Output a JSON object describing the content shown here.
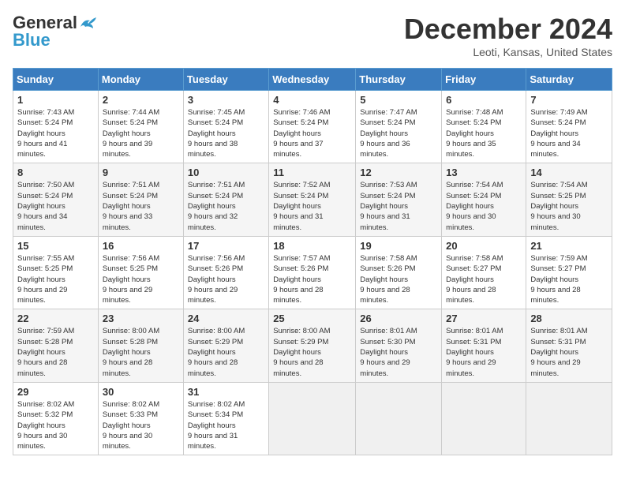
{
  "header": {
    "logo_general": "General",
    "logo_blue": "Blue",
    "title": "December 2024",
    "location": "Leoti, Kansas, United States"
  },
  "weekdays": [
    "Sunday",
    "Monday",
    "Tuesday",
    "Wednesday",
    "Thursday",
    "Friday",
    "Saturday"
  ],
  "weeks": [
    [
      {
        "day": "1",
        "sunrise": "7:43 AM",
        "sunset": "5:24 PM",
        "daylight": "9 hours and 41 minutes."
      },
      {
        "day": "2",
        "sunrise": "7:44 AM",
        "sunset": "5:24 PM",
        "daylight": "9 hours and 39 minutes."
      },
      {
        "day": "3",
        "sunrise": "7:45 AM",
        "sunset": "5:24 PM",
        "daylight": "9 hours and 38 minutes."
      },
      {
        "day": "4",
        "sunrise": "7:46 AM",
        "sunset": "5:24 PM",
        "daylight": "9 hours and 37 minutes."
      },
      {
        "day": "5",
        "sunrise": "7:47 AM",
        "sunset": "5:24 PM",
        "daylight": "9 hours and 36 minutes."
      },
      {
        "day": "6",
        "sunrise": "7:48 AM",
        "sunset": "5:24 PM",
        "daylight": "9 hours and 35 minutes."
      },
      {
        "day": "7",
        "sunrise": "7:49 AM",
        "sunset": "5:24 PM",
        "daylight": "9 hours and 34 minutes."
      }
    ],
    [
      {
        "day": "8",
        "sunrise": "7:50 AM",
        "sunset": "5:24 PM",
        "daylight": "9 hours and 34 minutes."
      },
      {
        "day": "9",
        "sunrise": "7:51 AM",
        "sunset": "5:24 PM",
        "daylight": "9 hours and 33 minutes."
      },
      {
        "day": "10",
        "sunrise": "7:51 AM",
        "sunset": "5:24 PM",
        "daylight": "9 hours and 32 minutes."
      },
      {
        "day": "11",
        "sunrise": "7:52 AM",
        "sunset": "5:24 PM",
        "daylight": "9 hours and 31 minutes."
      },
      {
        "day": "12",
        "sunrise": "7:53 AM",
        "sunset": "5:24 PM",
        "daylight": "9 hours and 31 minutes."
      },
      {
        "day": "13",
        "sunrise": "7:54 AM",
        "sunset": "5:24 PM",
        "daylight": "9 hours and 30 minutes."
      },
      {
        "day": "14",
        "sunrise": "7:54 AM",
        "sunset": "5:25 PM",
        "daylight": "9 hours and 30 minutes."
      }
    ],
    [
      {
        "day": "15",
        "sunrise": "7:55 AM",
        "sunset": "5:25 PM",
        "daylight": "9 hours and 29 minutes."
      },
      {
        "day": "16",
        "sunrise": "7:56 AM",
        "sunset": "5:25 PM",
        "daylight": "9 hours and 29 minutes."
      },
      {
        "day": "17",
        "sunrise": "7:56 AM",
        "sunset": "5:26 PM",
        "daylight": "9 hours and 29 minutes."
      },
      {
        "day": "18",
        "sunrise": "7:57 AM",
        "sunset": "5:26 PM",
        "daylight": "9 hours and 28 minutes."
      },
      {
        "day": "19",
        "sunrise": "7:58 AM",
        "sunset": "5:26 PM",
        "daylight": "9 hours and 28 minutes."
      },
      {
        "day": "20",
        "sunrise": "7:58 AM",
        "sunset": "5:27 PM",
        "daylight": "9 hours and 28 minutes."
      },
      {
        "day": "21",
        "sunrise": "7:59 AM",
        "sunset": "5:27 PM",
        "daylight": "9 hours and 28 minutes."
      }
    ],
    [
      {
        "day": "22",
        "sunrise": "7:59 AM",
        "sunset": "5:28 PM",
        "daylight": "9 hours and 28 minutes."
      },
      {
        "day": "23",
        "sunrise": "8:00 AM",
        "sunset": "5:28 PM",
        "daylight": "9 hours and 28 minutes."
      },
      {
        "day": "24",
        "sunrise": "8:00 AM",
        "sunset": "5:29 PM",
        "daylight": "9 hours and 28 minutes."
      },
      {
        "day": "25",
        "sunrise": "8:00 AM",
        "sunset": "5:29 PM",
        "daylight": "9 hours and 28 minutes."
      },
      {
        "day": "26",
        "sunrise": "8:01 AM",
        "sunset": "5:30 PM",
        "daylight": "9 hours and 29 minutes."
      },
      {
        "day": "27",
        "sunrise": "8:01 AM",
        "sunset": "5:31 PM",
        "daylight": "9 hours and 29 minutes."
      },
      {
        "day": "28",
        "sunrise": "8:01 AM",
        "sunset": "5:31 PM",
        "daylight": "9 hours and 29 minutes."
      }
    ],
    [
      {
        "day": "29",
        "sunrise": "8:02 AM",
        "sunset": "5:32 PM",
        "daylight": "9 hours and 30 minutes."
      },
      {
        "day": "30",
        "sunrise": "8:02 AM",
        "sunset": "5:33 PM",
        "daylight": "9 hours and 30 minutes."
      },
      {
        "day": "31",
        "sunrise": "8:02 AM",
        "sunset": "5:34 PM",
        "daylight": "9 hours and 31 minutes."
      },
      null,
      null,
      null,
      null
    ]
  ]
}
